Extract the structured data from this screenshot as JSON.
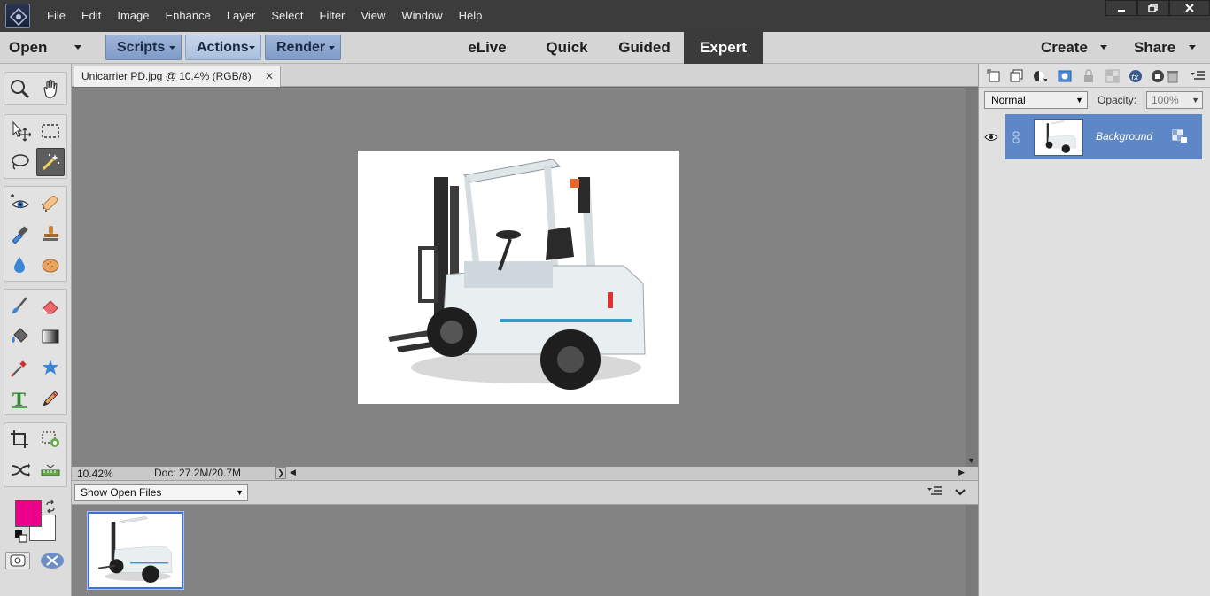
{
  "menubar": {
    "items": [
      "File",
      "Edit",
      "Image",
      "Enhance",
      "Layer",
      "Select",
      "Filter",
      "View",
      "Window",
      "Help"
    ]
  },
  "modebar": {
    "open_label": "Open",
    "scripts_label": "Scripts",
    "actions_label": "Actions",
    "render_label": "Render",
    "modes": [
      "eLive",
      "Quick",
      "Guided",
      "Expert"
    ],
    "active_mode": "Expert",
    "create_label": "Create",
    "share_label": "Share"
  },
  "document": {
    "tab_title": "Unicarrier PD.jpg @ 10.4% (RGB/8)",
    "zoom": "10.42%",
    "doc_size": "Doc: 27.2M/20.7M"
  },
  "photo_bin": {
    "select_value": "Show Open Files"
  },
  "layers_panel": {
    "blend_mode": "Normal",
    "opacity_label": "Opacity:",
    "opacity_value": "100%",
    "layers": [
      {
        "name": "Background",
        "visible": true,
        "locked": true
      }
    ]
  },
  "colors": {
    "foreground": "#ec008c",
    "background": "#ffffff",
    "accent": "#5d87c6"
  }
}
